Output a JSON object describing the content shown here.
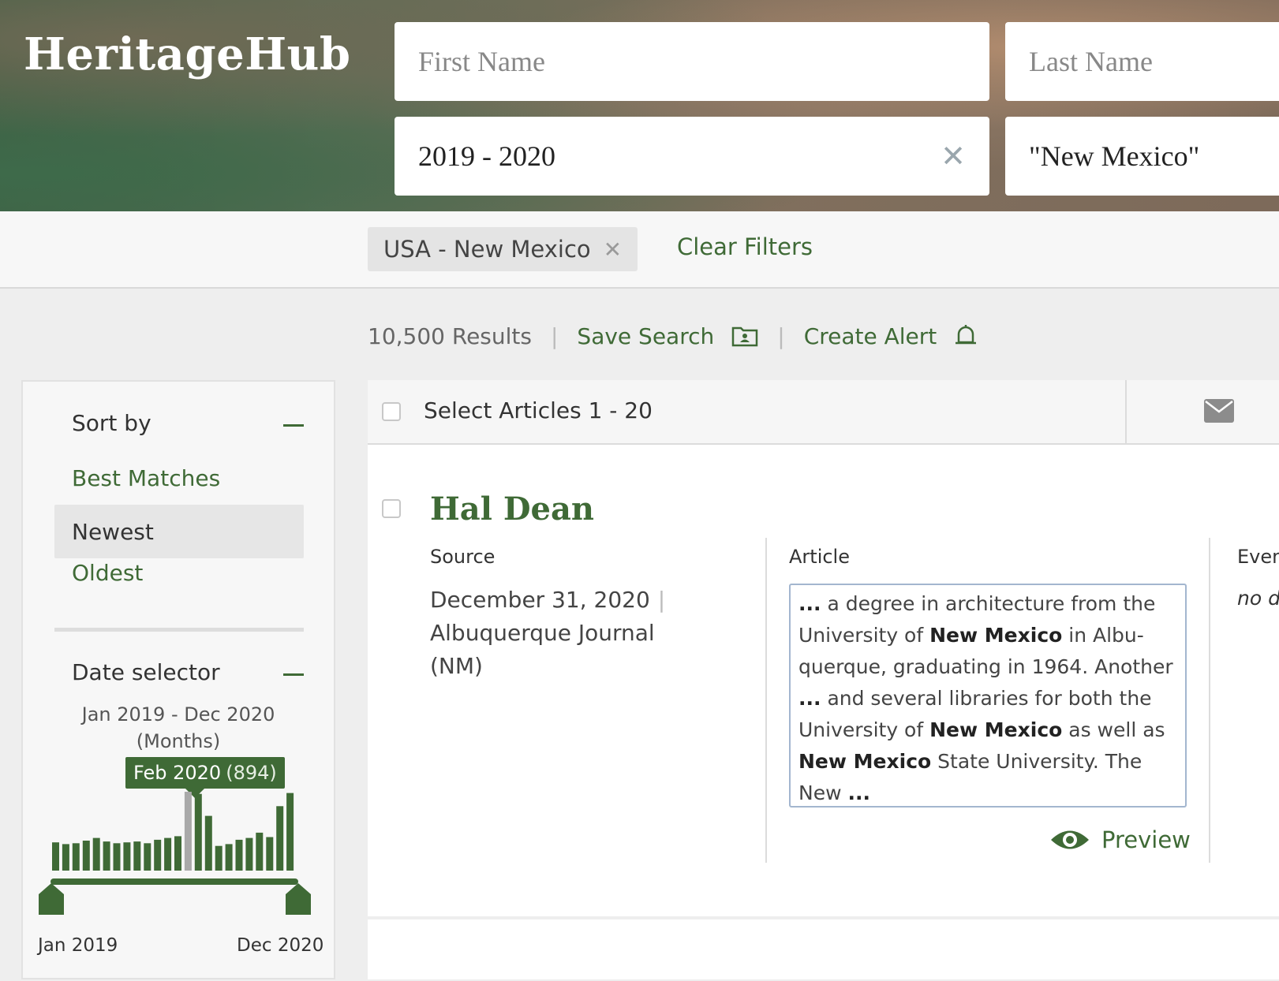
{
  "brand": {
    "name": "HeritageHub"
  },
  "search": {
    "first_name_placeholder": "First Name",
    "last_name_placeholder": "Last Name",
    "date_value": "2019 - 2020",
    "location_value": "\"New Mexico\"",
    "clear_symbol": "✕"
  },
  "filters": {
    "chip_label": "USA - New Mexico",
    "chip_close": "✕",
    "clear_filters": "Clear Filters"
  },
  "results": {
    "count": "10,500 Results",
    "separator": "|",
    "save_search": "Save Search",
    "create_alert": "Create Alert"
  },
  "sidebar": {
    "sort_heading": "Sort by",
    "sort_options": [
      "Best Matches",
      "Newest",
      "Oldest"
    ],
    "sort_selected": "Newest",
    "date_heading": "Date selector",
    "range_line1": "Jan 2019 - Dec 2020",
    "range_line2": "(Months)",
    "tooltip_label": "Feb 2020",
    "tooltip_count": "(894)",
    "axis_start": "Jan 2019",
    "axis_end": "Dec 2020"
  },
  "chart_data": {
    "type": "bar",
    "categories": [
      "Jan 2019",
      "Feb 2019",
      "Mar 2019",
      "Apr 2019",
      "May 2019",
      "Jun 2019",
      "Jul 2019",
      "Aug 2019",
      "Sep 2019",
      "Oct 2019",
      "Nov 2019",
      "Dec 2019",
      "Jan 2020",
      "Feb 2020",
      "Mar 2020",
      "Apr 2020",
      "May 2020",
      "Jun 2020",
      "Jul 2020",
      "Aug 2020",
      "Sep 2020",
      "Oct 2020",
      "Nov 2020",
      "Dec 2020"
    ],
    "values": [
      320,
      300,
      310,
      340,
      370,
      330,
      310,
      320,
      330,
      310,
      350,
      370,
      390,
      894,
      870,
      620,
      280,
      300,
      350,
      370,
      430,
      380,
      730,
      880
    ],
    "highlighted": "Feb 2020",
    "colors": {
      "bar": "#3f6a36",
      "highlight": "#a9a9a9"
    }
  },
  "main": {
    "select_label": "Select Articles 1 - 20",
    "article": {
      "title": "Hal Dean",
      "source_heading": "Source",
      "date": "December 31, 2020",
      "pipe": "|",
      "publication": "Albuquerque Journal (NM)",
      "article_heading": "Article",
      "event_heading": "Event",
      "event_value": "no date",
      "snippet": [
        [
          "b",
          "..."
        ],
        [
          "t",
          " a degree in architecture from the University of "
        ],
        [
          "b",
          "New Mexico"
        ],
        [
          "t",
          " in Albu- querque, graduating in 1964. Another "
        ],
        [
          "b",
          "..."
        ],
        [
          "t",
          " and several libraries for both the University of "
        ],
        [
          "b",
          "New Mexico"
        ],
        [
          "t",
          " as well as "
        ],
        [
          "b",
          "New Mexico"
        ],
        [
          "t",
          " State University. The New "
        ],
        [
          "b",
          "..."
        ]
      ],
      "preview": "Preview"
    }
  },
  "colors": {
    "accent": "#3f6a36",
    "snippet_border": "#a3b6cf"
  }
}
